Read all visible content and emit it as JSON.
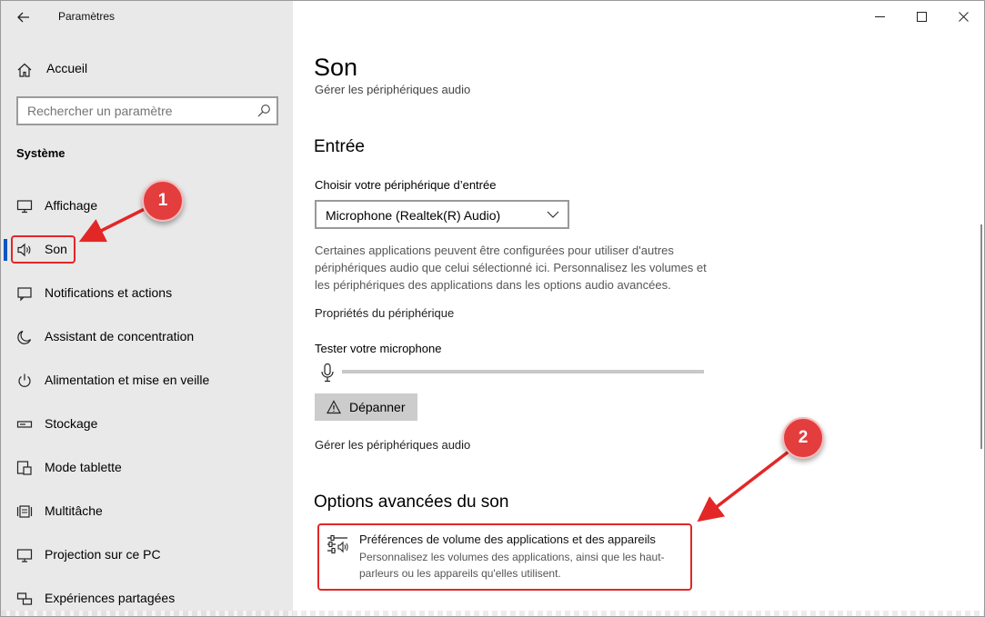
{
  "window": {
    "title": "Paramètres",
    "controls": {
      "minimize": "minimize-icon",
      "maximize": "maximize-icon",
      "close": "close-icon"
    }
  },
  "sidebar": {
    "home_label": "Accueil",
    "search_placeholder": "Rechercher un paramètre",
    "section_label": "Système",
    "items": [
      {
        "label": "Affichage",
        "icon": "monitor-icon"
      },
      {
        "label": "Son",
        "icon": "speaker-icon",
        "active": true
      },
      {
        "label": "Notifications et actions",
        "icon": "notification-icon"
      },
      {
        "label": "Assistant de concentration",
        "icon": "moon-icon"
      },
      {
        "label": "Alimentation et mise en veille",
        "icon": "power-icon"
      },
      {
        "label": "Stockage",
        "icon": "storage-icon"
      },
      {
        "label": "Mode tablette",
        "icon": "tablet-icon"
      },
      {
        "label": "Multitâche",
        "icon": "multitask-icon"
      },
      {
        "label": "Projection sur ce PC",
        "icon": "projection-icon"
      },
      {
        "label": "Expériences partagées",
        "icon": "shared-icon"
      }
    ]
  },
  "main": {
    "page_title": "Son",
    "cut_text": "Gérer les périphériques audio",
    "input_section": {
      "heading": "Entrée",
      "device_label": "Choisir votre périphérique d’entrée",
      "selected_device": "Microphone (Realtek(R) Audio)",
      "description": "Certaines applications peuvent être configurées pour utiliser d'autres périphériques audio que celui sélectionné ici. Personnalisez les volumes et les périphériques des applications dans les options audio avancées.",
      "device_properties_link": "Propriétés du périphérique",
      "test_mic_label": "Tester votre microphone",
      "mic_level": 0,
      "troubleshoot_label": "Dépanner",
      "manage_devices_link": "Gérer les périphériques audio"
    },
    "advanced_section": {
      "heading": "Options avancées du son",
      "item_title": "Préférences de volume des applications et des appareils",
      "item_subtitle": "Personnalisez les volumes des applications, ainsi que les haut-parleurs ou les appareils qu'elles utilisent."
    }
  },
  "annotations": {
    "badge_1": "1",
    "badge_2": "2",
    "accent_color": "#e33d3d"
  }
}
